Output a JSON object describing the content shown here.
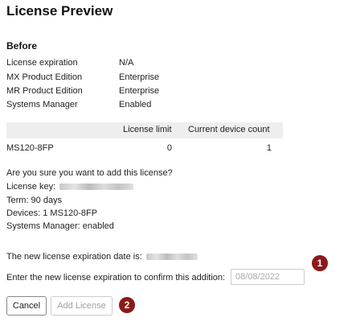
{
  "page": {
    "title": "License Preview"
  },
  "before": {
    "heading": "Before",
    "rows": [
      {
        "label": "License expiration",
        "value": "N/A"
      },
      {
        "label": "MX Product Edition",
        "value": "Enterprise"
      },
      {
        "label": "MR Product Edition",
        "value": "Enterprise"
      },
      {
        "label": "Systems Manager",
        "value": "Enabled"
      }
    ]
  },
  "table": {
    "headers": [
      "",
      "License limit",
      "Current device count"
    ],
    "rows": [
      {
        "model": "MS120-8FP",
        "license_limit": "0",
        "current_device_count": "1"
      }
    ]
  },
  "confirm": {
    "question": "Are you sure you want to add this license?",
    "license_key_label": "License key:",
    "term": "Term: 90 days",
    "devices": "Devices: 1 MS120-8FP",
    "systems_manager": "Systems Manager: enabled"
  },
  "expiration": {
    "new_date_label": "The new license expiration date is:",
    "prompt": "Enter the new license expiration to confirm this addition:",
    "input_placeholder": "08/08/2022",
    "input_value": ""
  },
  "buttons": {
    "cancel": "Cancel",
    "add_license": "Add License"
  },
  "callouts": {
    "one": "1",
    "two": "2"
  },
  "colors": {
    "callout": "#8b1a1a",
    "table_header_bg": "#eeeeee",
    "disabled_text": "#a0a0a0"
  }
}
